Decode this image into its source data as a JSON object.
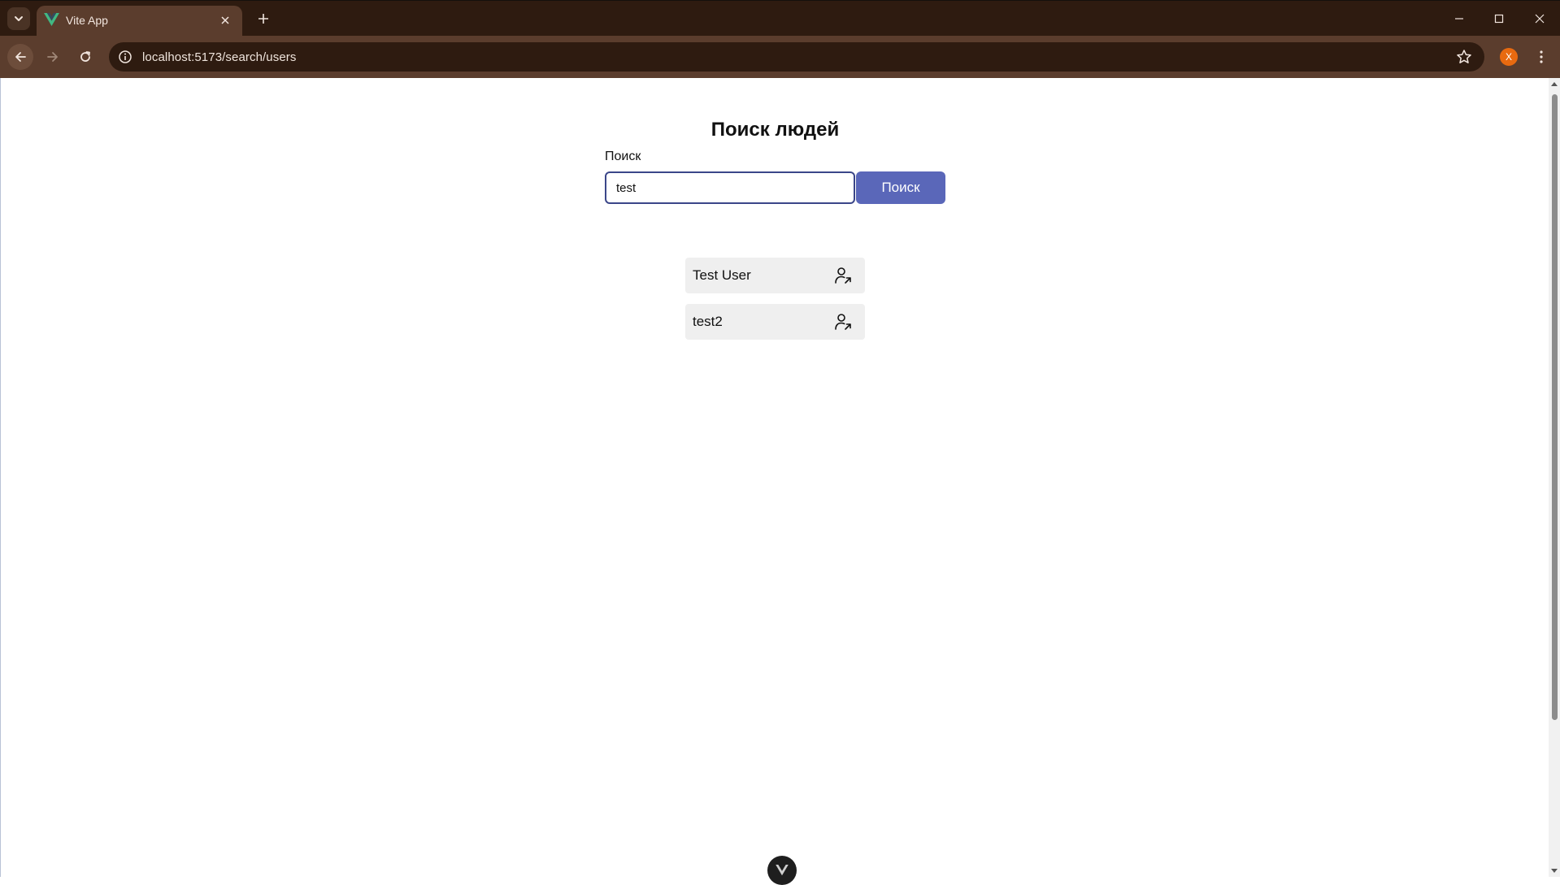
{
  "browser": {
    "tab": {
      "title": "Vite App",
      "favicon": "vue-logo-icon"
    },
    "address_bar": {
      "url": "localhost:5173/search/users"
    },
    "profile_initial": "X",
    "colors": {
      "tabstrip": "#2e1b10",
      "toolbar": "#5b3d2d",
      "profile": "#e86a10"
    }
  },
  "page": {
    "title": "Поиск людей",
    "search": {
      "label": "Поиск",
      "value": "test",
      "button_label": "Поиск"
    },
    "results": [
      {
        "name": "Test User",
        "icon": "user-link-icon"
      },
      {
        "name": "test2",
        "icon": "user-link-icon"
      }
    ],
    "colors": {
      "accent": "#5a67b9",
      "input_border": "#3b4689",
      "result_bg": "#efefef"
    }
  }
}
